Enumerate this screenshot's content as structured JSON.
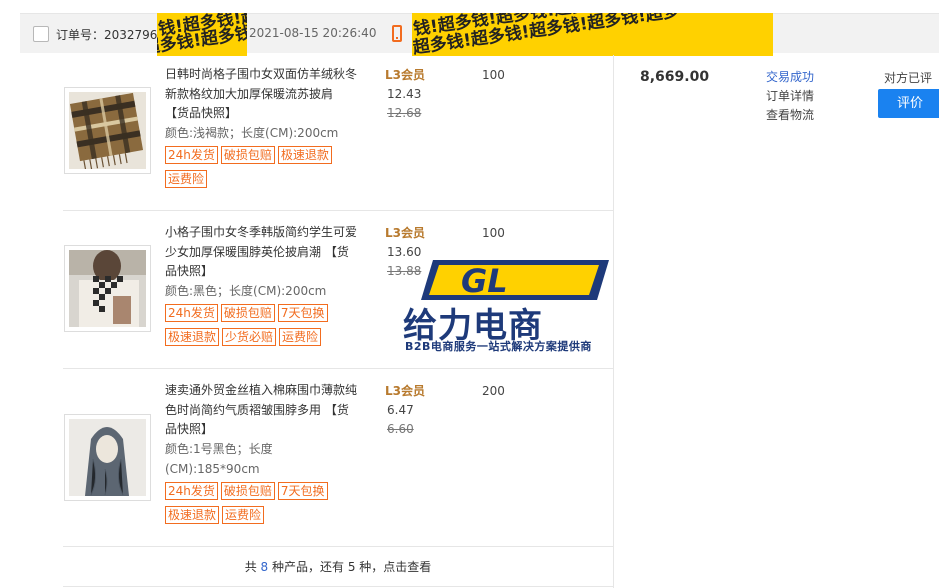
{
  "header": {
    "order_label": "订单号：2032796",
    "order_time": "2021-08-15 20:26:40"
  },
  "products": [
    {
      "title": "日韩时尚格子围巾女双面仿羊绒秋冬新款格纹加大加厚保暖流苏披肩 【货品快照】",
      "spec": "颜色:浅褐款；长度(CM):200cm",
      "tags": [
        "24h发货",
        "破损包赔",
        "极速退款",
        "运费险"
      ],
      "member": "L3会员",
      "price": "12.43",
      "old_price": "12.68",
      "qty": "100"
    },
    {
      "title": "小格子围巾女冬季韩版简约学生可爱少女加厚保暖围脖英伦披肩潮 【货品快照】",
      "spec": "颜色:黑色；长度(CM):200cm",
      "tags": [
        "24h发货",
        "破损包赔",
        "7天包换",
        "极速退款",
        "少货必赔",
        "运费险"
      ],
      "member": "L3会员",
      "price": "13.60",
      "old_price": "13.88",
      "qty": "100"
    },
    {
      "title": "速卖通外贸金丝植入棉麻围巾薄款纯色时尚简约气质褶皱围脖多用 【货品快照】",
      "spec": "颜色:1号黑色；长度(CM):185*90cm",
      "tags": [
        "24h发货",
        "破损包赔",
        "7天包换",
        "极速退款",
        "运费险"
      ],
      "member": "L3会员",
      "price": "6.47",
      "old_price": "6.60",
      "qty": "200"
    }
  ],
  "footer": {
    "prefix": "共 ",
    "count": "8",
    "suffix": " 种产品，还有 5 种，点击查看"
  },
  "order_summary": {
    "total": "8,669.00",
    "status": "交易成功",
    "detail_link": "订单详情",
    "logistics_link": "查看物流",
    "peer_label": "对方已评",
    "rate_button": "评价"
  },
  "watermark": {
    "logo_text": "GL",
    "name": "给力电商",
    "slogan": "B2B电商服务一站式解决方案提供商"
  },
  "mosaic_text": "钱!超多钱!超多钱!超多钱!超多钱!超多",
  "colors": {
    "accent_orange": "#f26c1f",
    "link_blue": "#3366cc",
    "button_blue": "#1a82f0",
    "mosaic_yellow": "#ffd100",
    "watermark_navy": "#1e3a7a"
  }
}
